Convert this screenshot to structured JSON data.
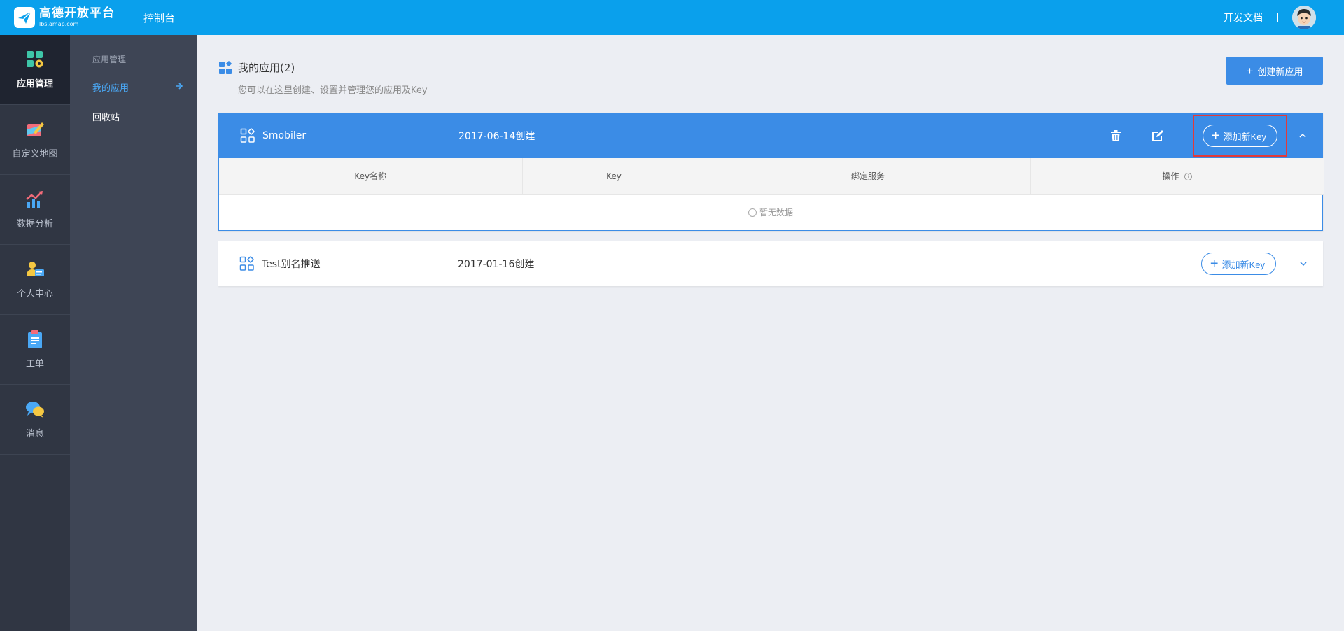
{
  "header": {
    "logo_title": "高德开放平台",
    "logo_url": "lbs.amap.com",
    "console_title": "控制台",
    "docs_link": "开发文档"
  },
  "leftnav": {
    "items": [
      {
        "label": "应用管理",
        "icon": "grid-gear-icon",
        "active": true
      },
      {
        "label": "自定义地图",
        "icon": "map-palette-icon"
      },
      {
        "label": "数据分析",
        "icon": "chart-trend-icon"
      },
      {
        "label": "个人中心",
        "icon": "user-card-icon"
      },
      {
        "label": "工单",
        "icon": "clipboard-icon"
      },
      {
        "label": "消息",
        "icon": "chat-bubble-icon"
      }
    ]
  },
  "subnav": {
    "group_label": "应用管理",
    "items": [
      {
        "label": "我的应用",
        "active": true
      },
      {
        "label": "回收站"
      }
    ]
  },
  "page": {
    "title": "我的应用(2)",
    "subtitle": "您可以在这里创建、设置并管理您的应用及Key",
    "create_button": "创建新应用"
  },
  "apps": [
    {
      "name": "Smobiler",
      "created": "2017-06-14创建",
      "add_key": "添加新Key",
      "expanded": true,
      "table": {
        "columns": [
          "Key名称",
          "Key",
          "绑定服务",
          "操作"
        ],
        "empty_text": "暂无数据"
      }
    },
    {
      "name": "Test别名推送",
      "created": "2017-01-16创建",
      "add_key": "添加新Key",
      "expanded": false
    }
  ],
  "colors": {
    "header_bg": "#0aa0ec",
    "accent": "#3b8ce6",
    "highlight_box": "#e23a3a",
    "leftnav_bg": "#303643",
    "subnav_bg": "#3e4555"
  }
}
